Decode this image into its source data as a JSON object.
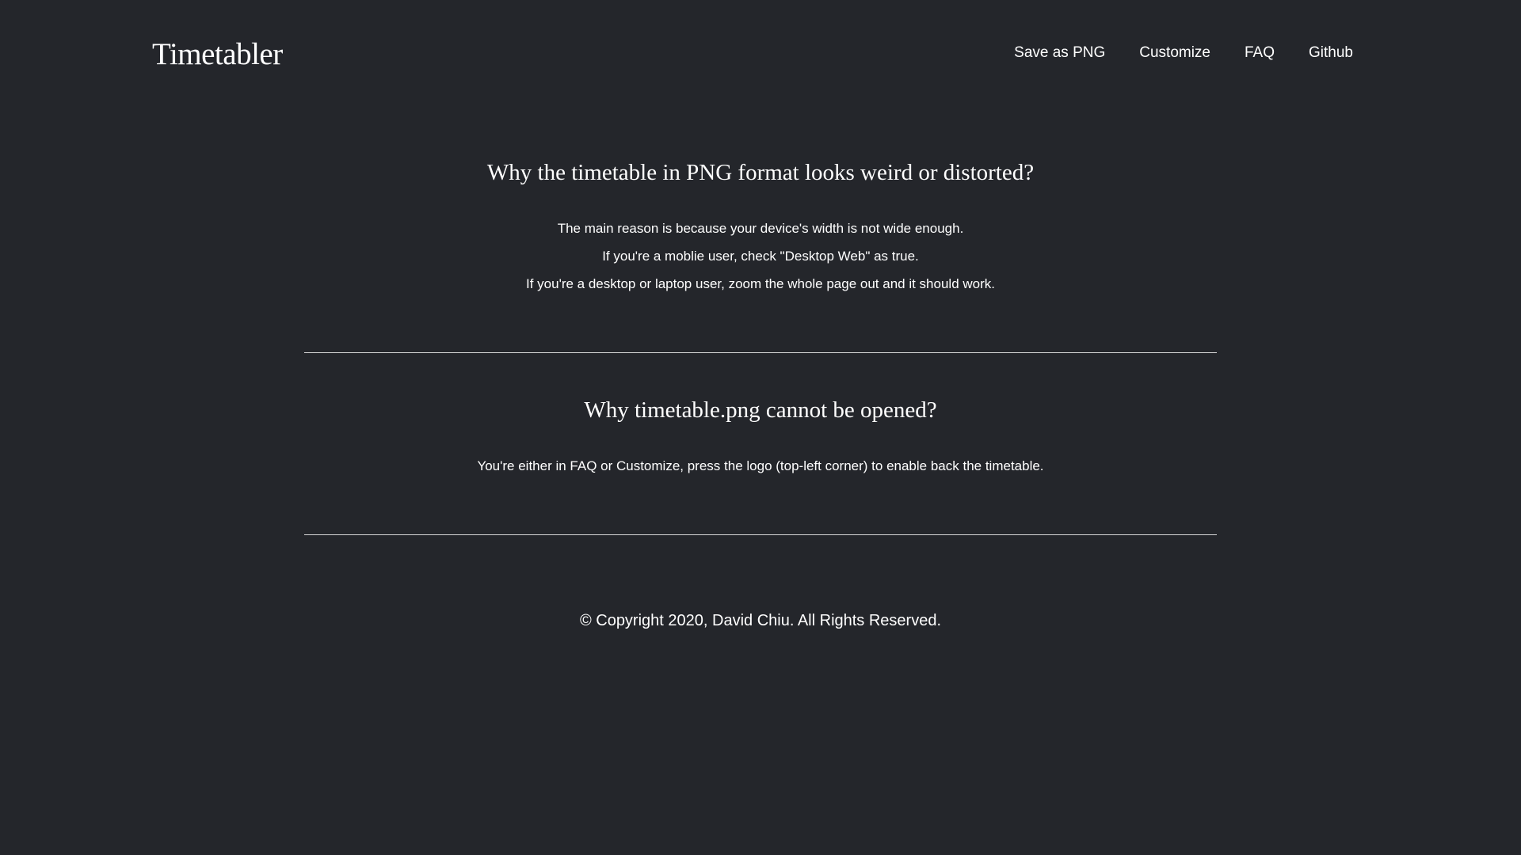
{
  "header": {
    "logo": "Timetabler",
    "nav": [
      {
        "label": "Save as PNG"
      },
      {
        "label": "Customize"
      },
      {
        "label": "FAQ"
      },
      {
        "label": "Github"
      }
    ]
  },
  "faq": [
    {
      "question": "Why the timetable in PNG format looks weird or distorted?",
      "answer_lines": [
        "The main reason is because your device's width is not wide enough.",
        "If you're a moblie user, check \"Desktop Web\" as true.",
        "If you're a desktop or laptop user, zoom the whole page out and it should work."
      ]
    },
    {
      "question": "Why timetable.png cannot be opened?",
      "answer_lines": [
        "You're either in FAQ or Customize, press the logo (top-left corner) to enable back the timetable."
      ]
    }
  ],
  "footer": {
    "copyright": "© Copyright 2020, David Chiu. All Rights Reserved."
  },
  "colors": {
    "background": "#24262b",
    "text": "#ffffff",
    "divider": "#d9d9d9"
  }
}
